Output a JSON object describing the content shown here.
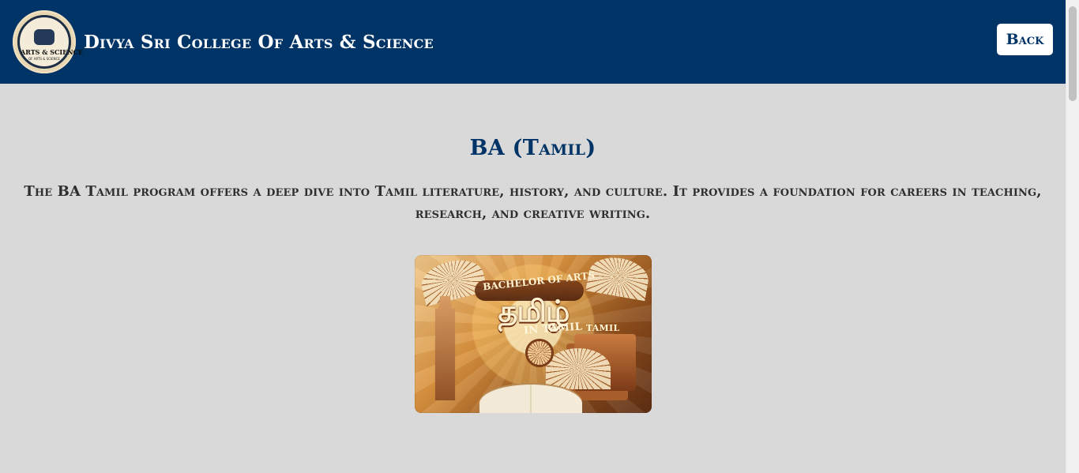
{
  "header": {
    "logo_name": "college-seal",
    "logo_text": "ARTS & SCIENCE",
    "logo_subtext": "OF ARTS & SCIENCE",
    "college_name": "Divya Sri College Of Arts & Science",
    "back_label": "Back"
  },
  "program": {
    "title": "BA (Tamil)",
    "description": "The BA Tamil program offers a deep dive into Tamil literature, history, and culture. It provides a foundation for careers in teaching, research, and creative writing.",
    "image": {
      "banner_text": "BACHELOR OF ARTS",
      "tamil_text": "தமிழ்",
      "subtitle": "IN TAMIL",
      "book_text": "TAMIL"
    }
  },
  "colors": {
    "header_bg": "#003366",
    "page_bg": "#d9d9d9",
    "accent": "#003366",
    "button_bg": "#ffffff"
  }
}
